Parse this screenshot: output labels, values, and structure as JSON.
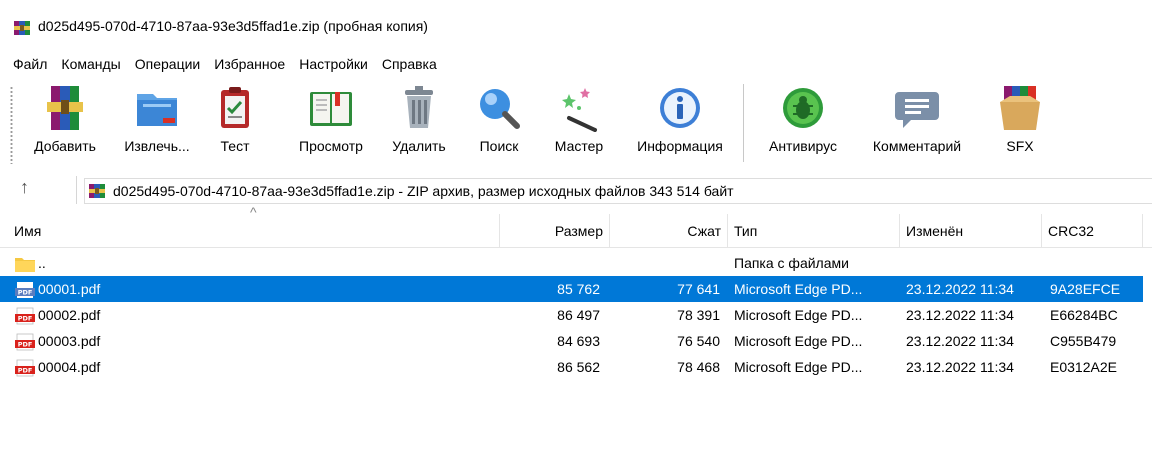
{
  "window": {
    "title": "d025d495-070d-4710-87aa-93e3d5ffad1e.zip (пробная копия)",
    "icon": "winrar-archive-icon"
  },
  "menu": [
    "Файл",
    "Команды",
    "Операции",
    "Избранное",
    "Настройки",
    "Справка"
  ],
  "toolbar": [
    {
      "label": "Добавить",
      "icon": "add-archive-icon"
    },
    {
      "label": "Извлечь...",
      "icon": "extract-icon"
    },
    {
      "label": "Тест",
      "icon": "test-icon"
    },
    {
      "label": "Просмотр",
      "icon": "view-book-icon"
    },
    {
      "label": "Удалить",
      "icon": "trash-icon"
    },
    {
      "label": "Поиск",
      "icon": "search-icon"
    },
    {
      "label": "Мастер",
      "icon": "wizard-wand-icon"
    },
    {
      "label": "Информация",
      "icon": "info-icon"
    },
    {
      "label": "Антивирус",
      "icon": "antivirus-bug-icon"
    },
    {
      "label": "Комментарий",
      "icon": "comment-icon"
    },
    {
      "label": "SFX",
      "icon": "sfx-box-icon"
    }
  ],
  "address": {
    "up": "↑",
    "text": "d025d495-070d-4710-87aa-93e3d5ffad1e.zip - ZIP архив, размер исходных файлов 343 514 байт"
  },
  "columns": {
    "name": "Имя",
    "size": "Размер",
    "packed": "Сжат",
    "type": "Тип",
    "modified": "Изменён",
    "crc": "CRC32"
  },
  "rows": [
    {
      "name": "..",
      "size": "",
      "packed": "",
      "type": "Папка с файлами",
      "modified": "",
      "crc": "",
      "icon": "folder-icon",
      "selected": false
    },
    {
      "name": "00001.pdf",
      "size": "85 762",
      "packed": "77 641",
      "type": "Microsoft Edge PD...",
      "modified": "23.12.2022 11:34",
      "crc": "9A28EFCE",
      "icon": "pdf-icon",
      "selected": true
    },
    {
      "name": "00002.pdf",
      "size": "86 497",
      "packed": "78 391",
      "type": "Microsoft Edge PD...",
      "modified": "23.12.2022 11:34",
      "crc": "E66284BC",
      "icon": "pdf-icon",
      "selected": false
    },
    {
      "name": "00003.pdf",
      "size": "84 693",
      "packed": "76 540",
      "type": "Microsoft Edge PD...",
      "modified": "23.12.2022 11:34",
      "crc": "C955B479",
      "icon": "pdf-icon",
      "selected": false
    },
    {
      "name": "00004.pdf",
      "size": "86 562",
      "packed": "78 468",
      "type": "Microsoft Edge PD...",
      "modified": "23.12.2022 11:34",
      "crc": "E0312A2E",
      "icon": "pdf-icon",
      "selected": false
    }
  ],
  "colors": {
    "selection": "#0078d7",
    "pdf_red": "#d9221c"
  }
}
